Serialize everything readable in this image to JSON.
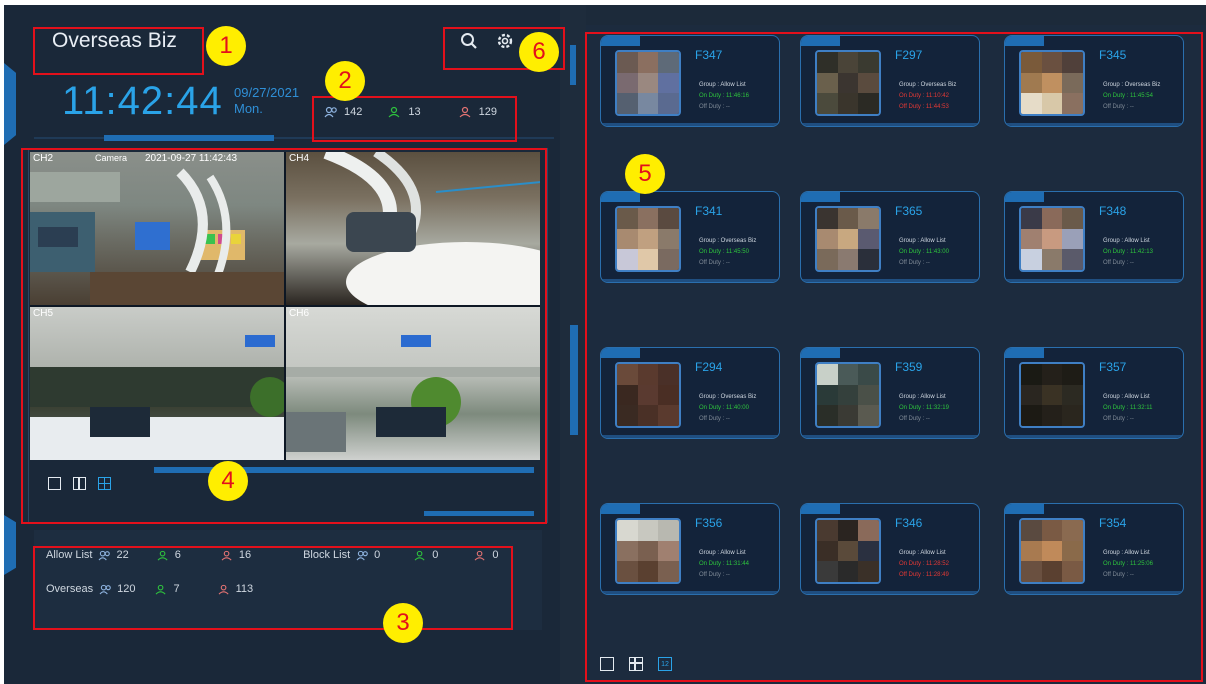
{
  "header": {
    "title": "Overseas Biz",
    "time": "11:42:44",
    "date": "09/27/2021",
    "weekday": "Mon.",
    "icons": [
      "search-icon",
      "gear-icon"
    ]
  },
  "summary_stats": {
    "total": "142",
    "on_duty": "13",
    "off_duty": "129"
  },
  "cameras": [
    {
      "channel": "CH2",
      "name": "Camera",
      "timestamp": "2021-09-27 11:42:43"
    },
    {
      "channel": "CH4",
      "name": "",
      "timestamp": ""
    },
    {
      "channel": "CH5",
      "name": "",
      "timestamp": ""
    },
    {
      "channel": "CH6",
      "name": "",
      "timestamp": ""
    }
  ],
  "lists": {
    "allow": {
      "label": "Allow List",
      "total": "22",
      "on": "6",
      "off": "16"
    },
    "block": {
      "label": "Block List",
      "total": "0",
      "on": "0",
      "off": "0"
    },
    "overseas": {
      "label": "Overseas",
      "total": "120",
      "on": "7",
      "off": "113"
    }
  },
  "cards": [
    {
      "id": "F347",
      "group": "Group : Allow List",
      "on": "On Duty : 11:46:16",
      "off": "Off Duty : --",
      "on_status": "green",
      "off_status": "gray"
    },
    {
      "id": "F297",
      "group": "Group : Overseas Biz",
      "on": "On Duty : 11:10:42",
      "off": "Off Duty : 11:44:53",
      "on_status": "red",
      "off_status": "red"
    },
    {
      "id": "F345",
      "group": "Group : Overseas Biz",
      "on": "On Duty : 11:45:54",
      "off": "Off Duty : --",
      "on_status": "green",
      "off_status": "gray"
    },
    {
      "id": "F341",
      "group": "Group : Overseas Biz",
      "on": "On Duty : 11:45:50",
      "off": "Off Duty : --",
      "on_status": "green",
      "off_status": "gray"
    },
    {
      "id": "F365",
      "group": "Group : Allow List",
      "on": "On Duty : 11:43:00",
      "off": "Off Duty : --",
      "on_status": "green",
      "off_status": "gray"
    },
    {
      "id": "F348",
      "group": "Group : Allow List",
      "on": "On Duty : 11:42:13",
      "off": "Off Duty : --",
      "on_status": "green",
      "off_status": "gray"
    },
    {
      "id": "F294",
      "group": "Group : Overseas Biz",
      "on": "On Duty : 11:40:00",
      "off": "Off Duty : --",
      "on_status": "green",
      "off_status": "gray"
    },
    {
      "id": "F359",
      "group": "Group : Allow List",
      "on": "On Duty : 11:32:19",
      "off": "Off Duty : --",
      "on_status": "green",
      "off_status": "gray"
    },
    {
      "id": "F357",
      "group": "Group : Allow List",
      "on": "On Duty : 11:32:11",
      "off": "Off Duty : --",
      "on_status": "green",
      "off_status": "gray"
    },
    {
      "id": "F356",
      "group": "Group : Allow List",
      "on": "On Duty : 11:31:44",
      "off": "Off Duty : --",
      "on_status": "green",
      "off_status": "gray"
    },
    {
      "id": "F346",
      "group": "Group : Allow List",
      "on": "On Duty : 11:28:52",
      "off": "Off Duty : 11:28:49",
      "on_status": "red",
      "off_status": "red"
    },
    {
      "id": "F354",
      "group": "Group : Allow List",
      "on": "On Duty : 11:25:06",
      "off": "Off Duty : --",
      "on_status": "green",
      "off_status": "gray"
    }
  ],
  "right_view_modes": {
    "active_label": "12"
  },
  "annotations": [
    "1",
    "2",
    "3",
    "4",
    "5",
    "6"
  ],
  "colors": {
    "accent": "#2aa3e8",
    "panel": "#1c2a3a",
    "highlight": "#e3101b",
    "marker": "#ffee00"
  }
}
